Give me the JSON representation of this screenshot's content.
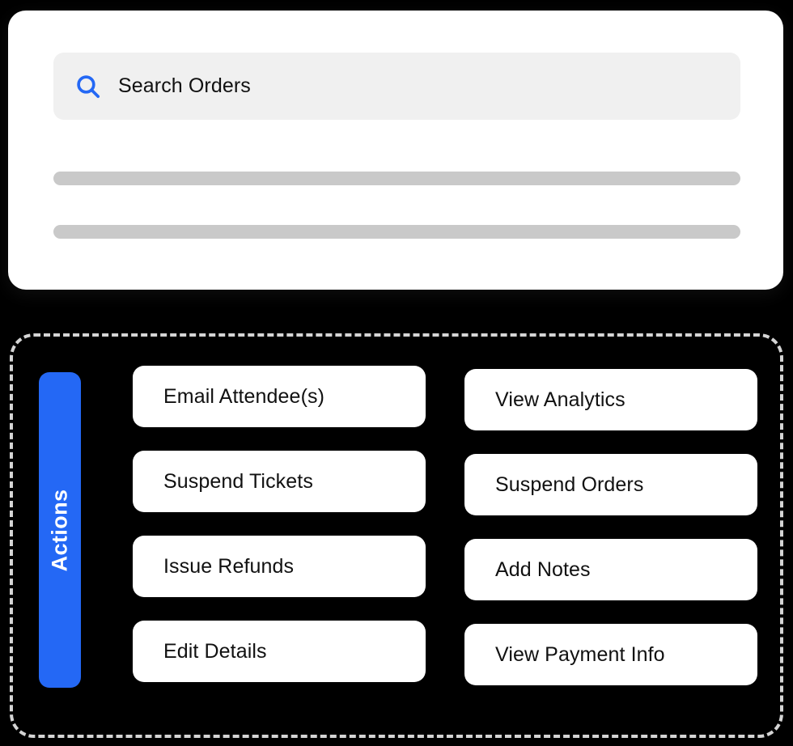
{
  "search_card": {
    "search": {
      "icon": "search-icon",
      "value": "",
      "placeholder": "Search Orders",
      "display_text": "Search Orders",
      "icon_color": "#2468f5",
      "field_background": "#f0f0f0"
    },
    "skeleton_rows": [
      {
        "name": "placeholder-bar-1"
      },
      {
        "name": "placeholder-bar-2"
      }
    ]
  },
  "actions_panel": {
    "tab_label": "Actions",
    "tab_color": "#2468f5",
    "border_color": "#d4d4d4",
    "columns": [
      {
        "name": "left-column",
        "buttons": [
          {
            "label": "Email Attendee(s)"
          },
          {
            "label": "Suspend Tickets"
          },
          {
            "label": "Issue Refunds"
          },
          {
            "label": "Edit Details"
          }
        ]
      },
      {
        "name": "right-column",
        "buttons": [
          {
            "label": "View Analytics"
          },
          {
            "label": "Suspend Orders"
          },
          {
            "label": "Add Notes"
          },
          {
            "label": "View Payment Info"
          }
        ]
      }
    ]
  },
  "theme": {
    "background": "#000000",
    "card_background": "#ffffff",
    "accent": "#2468f5",
    "skeleton": "#c9c9c9",
    "text": "#111111"
  }
}
